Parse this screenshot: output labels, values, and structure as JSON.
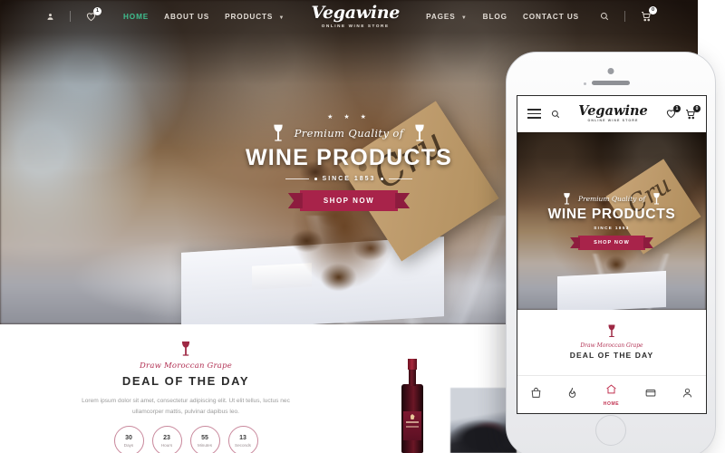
{
  "brand": {
    "name": "Vegawine",
    "tagline": "ONLINE WINE STORE",
    "accent_red": "#a8234a",
    "accent_green": "#3fbf8f",
    "deal_accent": "#b12f52"
  },
  "desktop": {
    "nav": {
      "account_icon": "user-icon",
      "wishlist_icon": "heart-icon",
      "wishlist_count": "1",
      "search_icon": "search-icon",
      "cart_icon": "cart-icon",
      "cart_count": "0",
      "items": [
        {
          "label": "HOME",
          "active": true,
          "dropdown": false
        },
        {
          "label": "ABOUT US",
          "active": false,
          "dropdown": false
        },
        {
          "label": "PRODUCTS",
          "active": false,
          "dropdown": true
        },
        {
          "label": "PAGES",
          "active": false,
          "dropdown": true
        },
        {
          "label": "BLOG",
          "active": false,
          "dropdown": false
        },
        {
          "label": "CONTACT US",
          "active": false,
          "dropdown": false
        }
      ]
    },
    "hero": {
      "stars": "★ ★ ★",
      "eyebrow": "Premium Quality of",
      "headline": "WINE PRODUCTS",
      "since": "SINCE 1853",
      "cta": "SHOP NOW",
      "glass_icon": "wine-glass-icon"
    },
    "deal": {
      "glass_icon": "wine-glass-icon",
      "script": "Draw Moroccan Grape",
      "title": "DEAL OF THE DAY",
      "body": "Lorem ipsum dolor sit amet, consectetur adipiscing elit. Ut elit tellus, luctus nec ullamcorper mattis, pulvinar dapibus leo.",
      "counters": [
        {
          "value": "30",
          "label": "Days"
        },
        {
          "value": "23",
          "label": "Hours"
        },
        {
          "value": "55",
          "label": "Minutes"
        },
        {
          "value": "13",
          "label": "Seconds"
        }
      ]
    }
  },
  "phone": {
    "header": {
      "menu_icon": "hamburger-menu-icon",
      "search_icon": "search-icon",
      "wishlist_icon": "heart-icon",
      "wishlist_count": "1",
      "cart_icon": "cart-icon",
      "cart_count": "0"
    },
    "hero": {
      "eyebrow": "Premium Quality of",
      "headline": "WINE PRODUCTS",
      "since": "SINCE 1853",
      "cta": "SHOP NOW",
      "glass_icon": "wine-glass-icon"
    },
    "deal": {
      "glass_icon": "wine-glass-icon",
      "script": "Draw Moroccan Grape",
      "title": "DEAL OF THE DAY"
    },
    "tabbar": [
      {
        "icon": "shopping-bag-icon",
        "label": "",
        "active": false
      },
      {
        "icon": "flame-icon",
        "label": "",
        "active": false
      },
      {
        "icon": "home-icon",
        "label": "HOME",
        "active": true
      },
      {
        "icon": "wallet-icon",
        "label": "",
        "active": false
      },
      {
        "icon": "user-icon",
        "label": "",
        "active": false
      }
    ]
  }
}
